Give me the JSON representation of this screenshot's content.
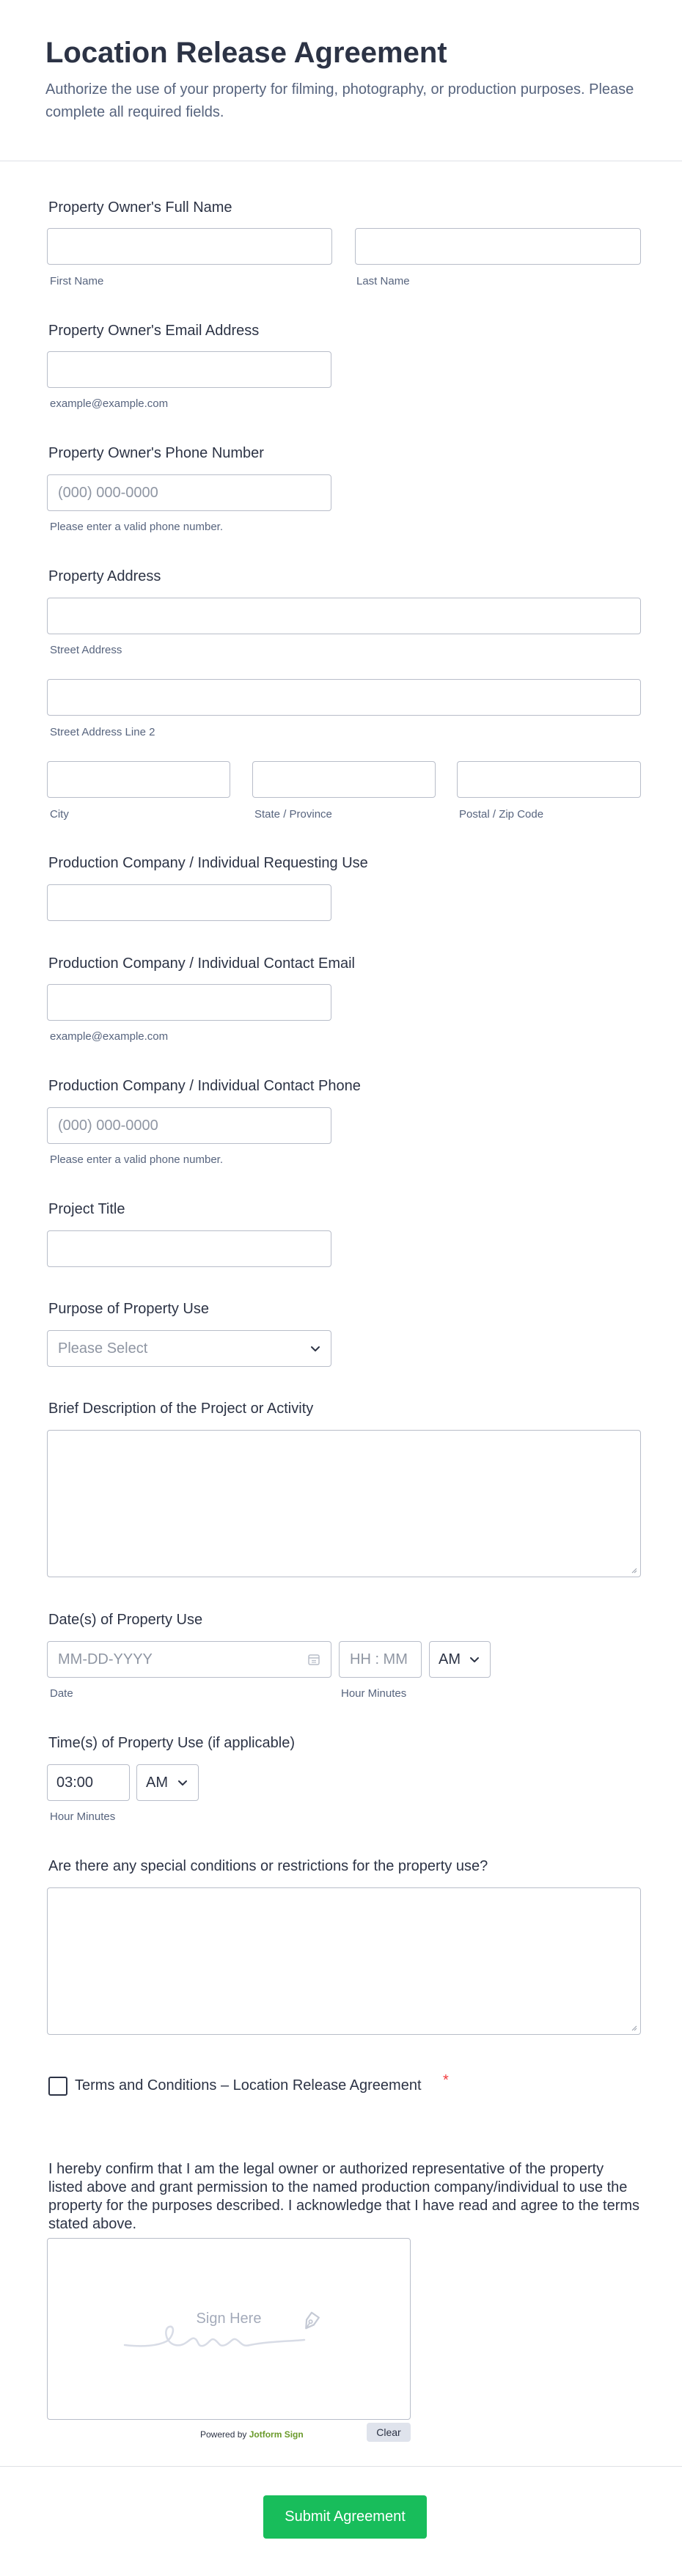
{
  "header": {
    "title": "Location Release Agreement",
    "subtitle": "Authorize the use of your property for filming, photography, or production purposes. Please complete all required fields."
  },
  "owner_name": {
    "label": "Property Owner's Full Name",
    "first_sub": "First Name",
    "last_sub": "Last Name"
  },
  "owner_email": {
    "label": "Property Owner's Email Address",
    "sub": "example@example.com"
  },
  "owner_phone": {
    "label": "Property Owner's Phone Number",
    "placeholder": "(000) 000-0000",
    "sub": "Please enter a valid phone number."
  },
  "address": {
    "label": "Property Address",
    "street_sub": "Street Address",
    "street2_sub": "Street Address Line 2",
    "city_sub": "City",
    "state_sub": "State / Province",
    "zip_sub": "Postal / Zip Code"
  },
  "company": {
    "label": "Production Company / Individual Requesting Use"
  },
  "company_email": {
    "label": "Production Company / Individual Contact Email",
    "sub": "example@example.com"
  },
  "company_phone": {
    "label": "Production Company / Individual Contact Phone",
    "placeholder": "(000) 000-0000",
    "sub": "Please enter a valid phone number."
  },
  "project_title": {
    "label": "Project Title"
  },
  "purpose": {
    "label": "Purpose of Property Use",
    "placeholder": "Please Select"
  },
  "description": {
    "label": "Brief Description of the Project or Activity"
  },
  "dates": {
    "label": "Date(s) of Property Use",
    "date_placeholder": "MM-DD-YYYY",
    "time_placeholder": "HH : MM",
    "ampm": "AM",
    "date_sub": "Date",
    "time_sub": "Hour Minutes"
  },
  "times": {
    "label": "Time(s) of Property Use (if applicable)",
    "value": "03:00",
    "ampm": "AM",
    "sub": "Hour Minutes"
  },
  "conditions": {
    "label": "Are there any special conditions or restrictions for the property use?"
  },
  "terms": {
    "label": "Terms and Conditions – Location Release Agreement",
    "required_mark": "*"
  },
  "declaration": {
    "text": "I hereby confirm that I am the legal owner or authorized representative of the property listed above and grant permission to the named production company/individual to use the property for the purposes described. I acknowledge that I have read and agree to the terms stated above."
  },
  "signature": {
    "placeholder": "Sign Here",
    "powered_prefix": "Powered by",
    "powered_brand": "Jotform Sign",
    "clear_label": "Clear"
  },
  "submit": {
    "label": "Submit Agreement"
  },
  "colors": {
    "accent": "#18bd5b",
    "required": "#f23a3c",
    "brand_green": "#6a9a2a"
  }
}
